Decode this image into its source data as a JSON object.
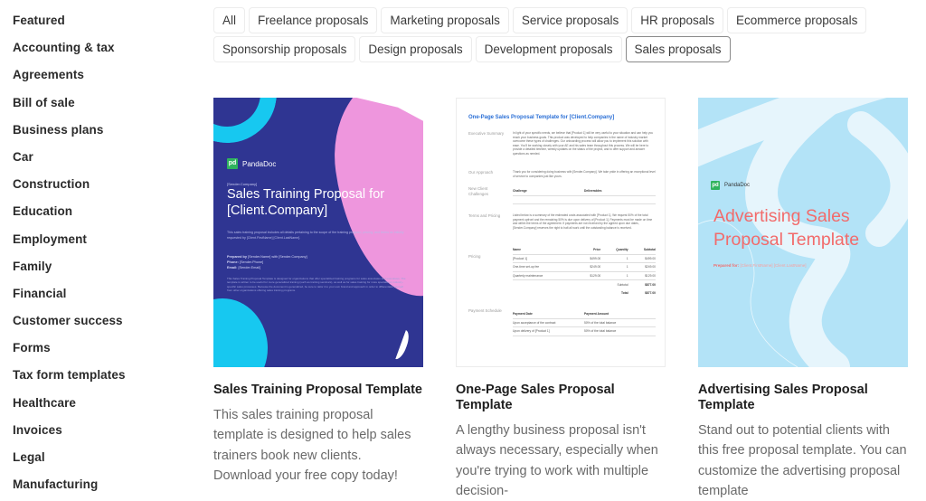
{
  "sidebar": {
    "items": [
      {
        "label": "Featured"
      },
      {
        "label": "Accounting & tax"
      },
      {
        "label": "Agreements"
      },
      {
        "label": "Bill of sale"
      },
      {
        "label": "Business plans"
      },
      {
        "label": "Car"
      },
      {
        "label": "Construction"
      },
      {
        "label": "Education"
      },
      {
        "label": "Employment"
      },
      {
        "label": "Family"
      },
      {
        "label": "Financial"
      },
      {
        "label": "Customer success"
      },
      {
        "label": "Forms"
      },
      {
        "label": "Tax form templates"
      },
      {
        "label": "Healthcare"
      },
      {
        "label": "Invoices"
      },
      {
        "label": "Legal"
      },
      {
        "label": "Manufacturing"
      }
    ]
  },
  "filters": {
    "row1": [
      {
        "label": "All",
        "active": false
      },
      {
        "label": "Freelance proposals",
        "active": false
      },
      {
        "label": "Marketing proposals",
        "active": false
      },
      {
        "label": "Service proposals",
        "active": false
      },
      {
        "label": "HR proposals",
        "active": false
      },
      {
        "label": "Ecommerce proposals",
        "active": false
      }
    ],
    "row2": [
      {
        "label": "Sponsorship proposals",
        "active": false
      },
      {
        "label": "Design proposals",
        "active": false
      },
      {
        "label": "Development proposals",
        "active": false
      },
      {
        "label": "Sales proposals",
        "active": true
      }
    ]
  },
  "cards": [
    {
      "title": "Sales Training Proposal Template",
      "description": "This sales training proposal template is designed to help sales trainers book new clients. Download your free copy today!",
      "thumb": {
        "brand": "PandaDoc",
        "logo_mark": "pd",
        "sender": "[Sender.Company]",
        "heading": "Sales Training Proposal for [Client.Company]",
        "intro": "This sales training proposal includes all details pertaining to the scope of the training program, pricing, and terms as initially requested by [Client.FirstName] [Client.LastName].",
        "prepared_by_label": "Prepared by",
        "prepared_by_value": "[Sender.Name] with [Sender.Company]",
        "phone_label": "Phone:",
        "phone_value": "[Sender.Phone]",
        "email_label": "Email:",
        "email_value": "[Sender.Email]",
        "fine_print": "This Sales Training Proposal Template is designed for organizations that offer specialized training programs for sales associates and executives. The template is written to be useful for more generalized training (such as training seminars), as well as for sales training for more specialized, industry-specific sales processes. Because the document is generalized, be sure to tailor it to your own brand and approach in order to differentiate yourself from other organizations offering sales training programs."
      }
    },
    {
      "title": "One-Page Sales Proposal Template",
      "description": "A lengthy business proposal isn't always necessary, especially when you're trying to work with multiple decision-",
      "thumb": {
        "heading": "One-Page Sales Proposal Template for [Client.Company]",
        "sections": {
          "executive_summary": "Executive Summary",
          "our_approach": "Our Approach",
          "new_client_challenges": "New Client Challenges",
          "terms_and_pricing": "Terms and Pricing",
          "pricing": "Pricing",
          "payment_schedule": "Payment Schedule"
        },
        "executive_summary_text": "In light of your specific needs, we believe that [Product 1] will be very useful to your situation and can help you reach your business goals. This product was developed to help companies in the name of industry market overcome these types of challenges. Our onboarding process will allow you to implement this solution with ease. You'll be working closely with your AE and his sales team throughout this process. We will be here to provide a detailed timeline, weekly updates on the status of the project, and to offer support and answer questions as needed.",
        "approach_text": "Thank you for considering doing business with [Sender.Company]. We take pride in offering an exceptional level of service to companies just like yours.",
        "challenges_headers": [
          "Challenge",
          "Deliverables"
        ],
        "terms_text": "Listed below is a summary of the estimated costs associated with [Product 1]. We request 50% of the total payment upfront and the remaining 50% is due upon delivery of [Product 1]. Payments must be made on time and within the terms of the agreement. If payments are not received by the agreed upon due dates, [Sender.Company] reserves the right to halt all work until the outstanding balance is received.",
        "pricing_headers": [
          "Name",
          "Price",
          "Quantity",
          "Subtotal"
        ],
        "pricing_rows": [
          [
            "[Product 1]",
            "$499.00",
            "1",
            "$499.00"
          ],
          [
            "One-time set-up fee",
            "$249.00",
            "1",
            "$249.00"
          ],
          [
            "Quarterly maintenance",
            "$129.00",
            "1",
            "$129.00"
          ]
        ],
        "subtotal_label": "Subtotal",
        "subtotal_value": "$877.00",
        "total_label": "Total",
        "total_value": "$877.00",
        "schedule_headers": [
          "Payment Date",
          "Payment Amount"
        ],
        "schedule_rows": [
          [
            "Upon acceptance of the contract",
            "50% of the total balance"
          ],
          [
            "Upon delivery of [Product 1]",
            "50% of the total balance"
          ]
        ]
      }
    },
    {
      "title": "Advertising Sales Proposal Template",
      "description": "Stand out to potential clients with this free proposal template. You can customize the advertising proposal template",
      "thumb": {
        "brand": "PandaDoc",
        "logo_mark": "pd",
        "heading": "Advertising Sales Proposal Template",
        "prepared_for_label": "Prepared for:",
        "prepared_for_value": "[Client.FirstName] [Client.LastName]"
      }
    }
  ],
  "colors": {
    "card1_bg": "#2f3592",
    "card1_pink": "#ee96dd",
    "card1_cyan": "#17c8f0",
    "card2_heading": "#2a6fd6",
    "card3_bg": "#b3e3f7",
    "card3_heading": "#f26b6b",
    "brand_green": "#2fb35e"
  }
}
